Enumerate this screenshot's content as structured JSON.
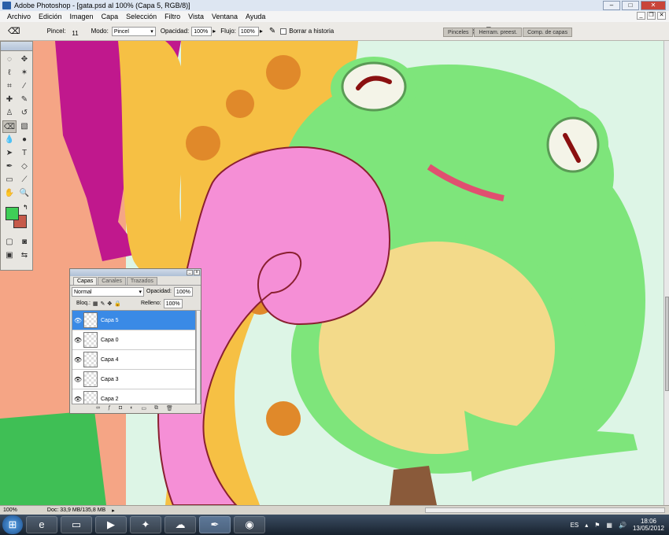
{
  "window": {
    "title": "Adobe Photoshop - [gata.psd al 100% (Capa 5, RGB/8)]"
  },
  "menu": [
    "Archivo",
    "Edición",
    "Imagen",
    "Capa",
    "Selección",
    "Filtro",
    "Vista",
    "Ventana",
    "Ayuda"
  ],
  "options": {
    "brush_label": "Pincel:",
    "brush_size": "11",
    "mode_label": "Modo:",
    "mode_value": "Pincel",
    "opacity_label": "Opacidad:",
    "opacity_value": "100%",
    "flow_label": "Flujo:",
    "flow_value": "100%",
    "erase_history": "Borrar a historia"
  },
  "palette_well": {
    "tabs": [
      "Pinceles",
      "Herram. preest.",
      "Comp. de capas"
    ]
  },
  "colors": {
    "foreground": "#3fce57",
    "background": "#c65a4a"
  },
  "layers_panel": {
    "tabs": [
      "Capas",
      "Canales",
      "Trazados"
    ],
    "blend_mode": "Normal",
    "opacity_label": "Opacidad:",
    "opacity_value": "100%",
    "lock_label": "Bloq.:",
    "fill_label": "Relleno:",
    "fill_value": "100%",
    "layers": [
      {
        "name": "Capa 5",
        "selected": true
      },
      {
        "name": "Capa 0",
        "selected": false
      },
      {
        "name": "Capa 4",
        "selected": false
      },
      {
        "name": "Capa 3",
        "selected": false
      },
      {
        "name": "Capa 2",
        "selected": false
      }
    ]
  },
  "status": {
    "zoom": "100%",
    "doc": "Doc: 33,9 MB/135,8 MB"
  },
  "taskbar": {
    "lang": "ES",
    "time": "18:06",
    "date": "13/05/2012"
  }
}
